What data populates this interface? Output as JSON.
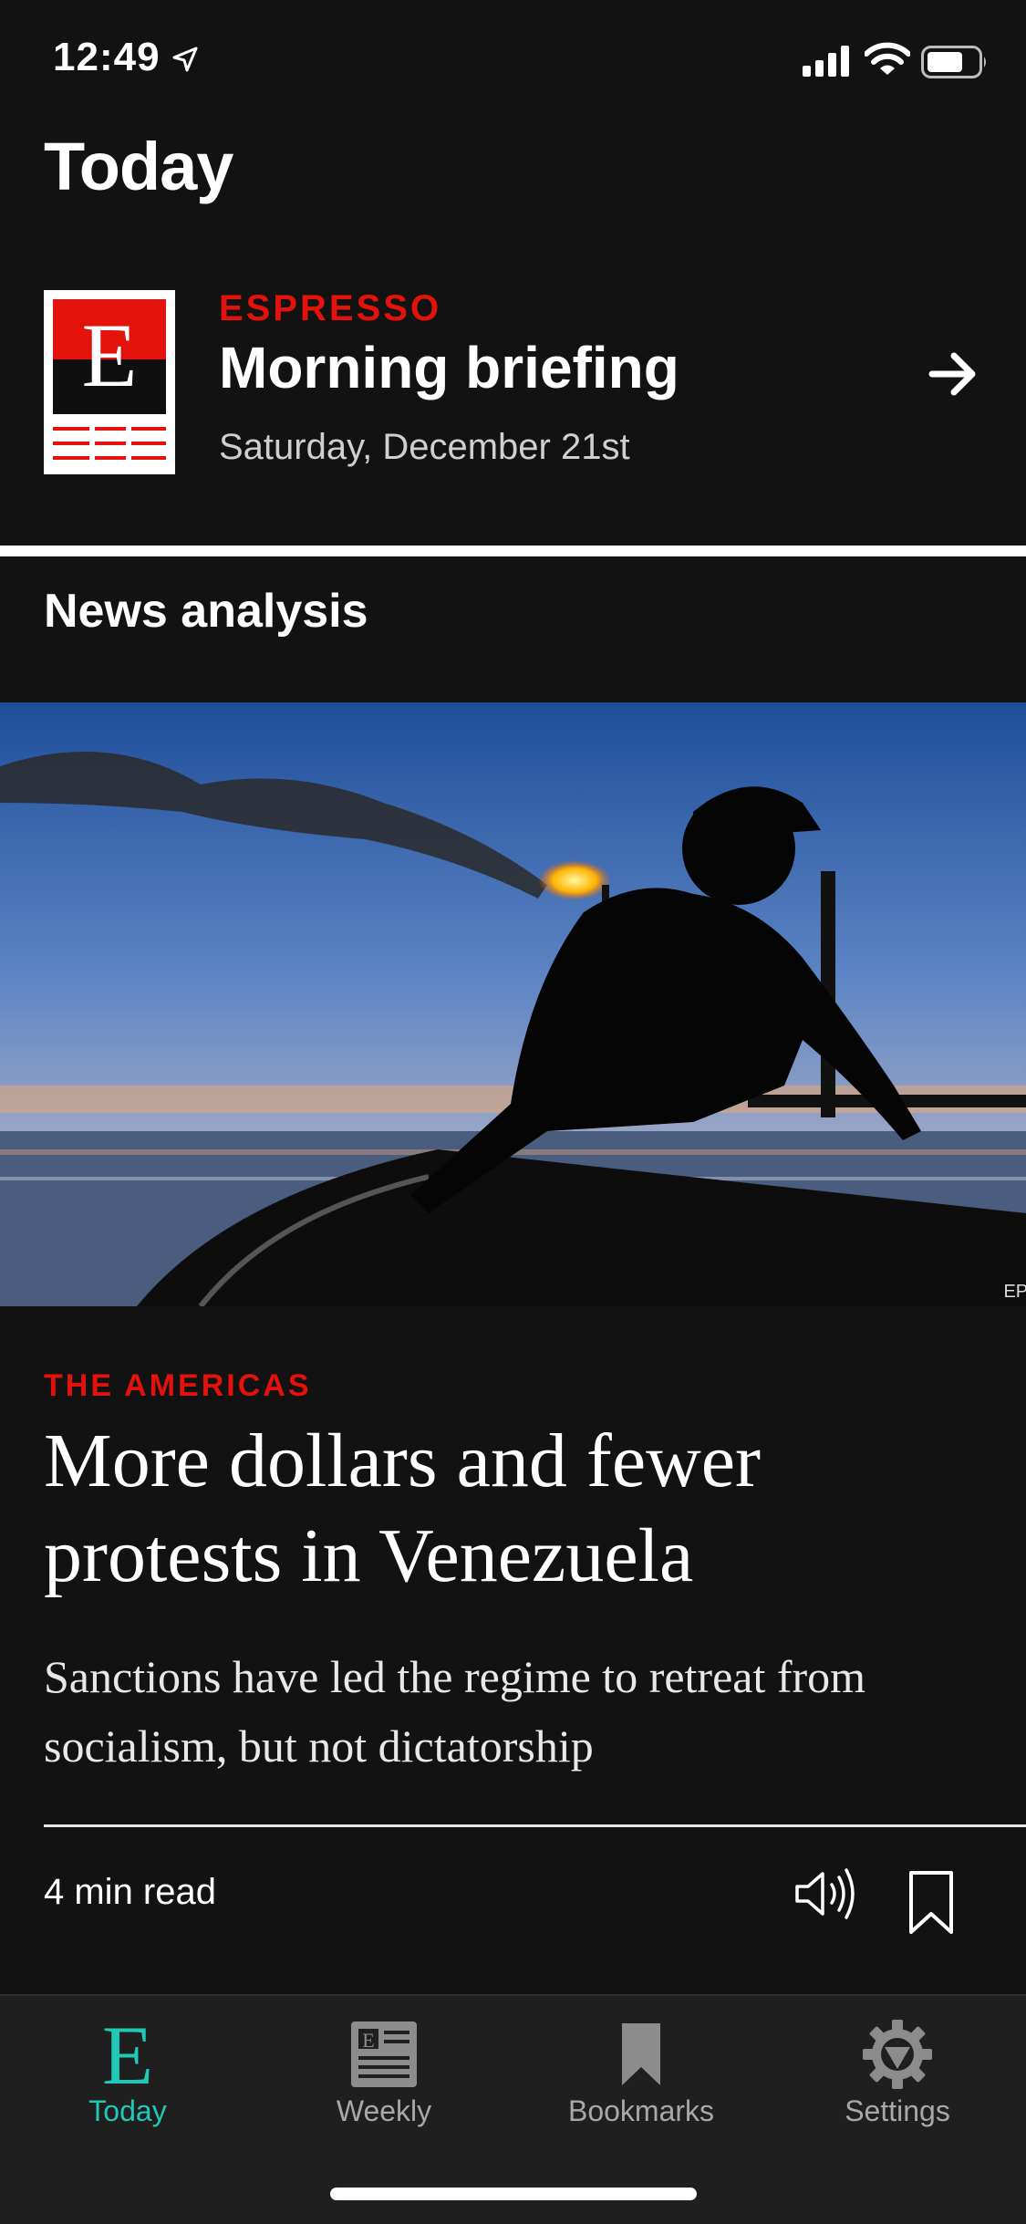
{
  "status_bar": {
    "time": "12:49"
  },
  "page": {
    "title": "Today"
  },
  "espresso": {
    "kicker": "ESPRESSO",
    "title": "Morning briefing",
    "date": "Saturday, December 21st",
    "logo_letter": "E"
  },
  "section": {
    "title": "News analysis"
  },
  "article": {
    "image_credit": "EPA",
    "kicker": "THE AMERICAS",
    "headline": "More dollars and fewer protests in Venezuela",
    "standfirst": "Sanctions have led the regime to retreat from socialism, but not dictatorship",
    "read_time": "4 min read"
  },
  "tabs": [
    {
      "label": "Today",
      "icon": "economist-e-icon",
      "active": true
    },
    {
      "label": "Weekly",
      "icon": "magazine-icon",
      "active": false
    },
    {
      "label": "Bookmarks",
      "icon": "bookmark-icon",
      "active": false
    },
    {
      "label": "Settings",
      "icon": "gear-icon",
      "active": false
    }
  ],
  "colors": {
    "accent_red": "#e3120b",
    "active_tab": "#20c9b5",
    "background": "#121212"
  }
}
